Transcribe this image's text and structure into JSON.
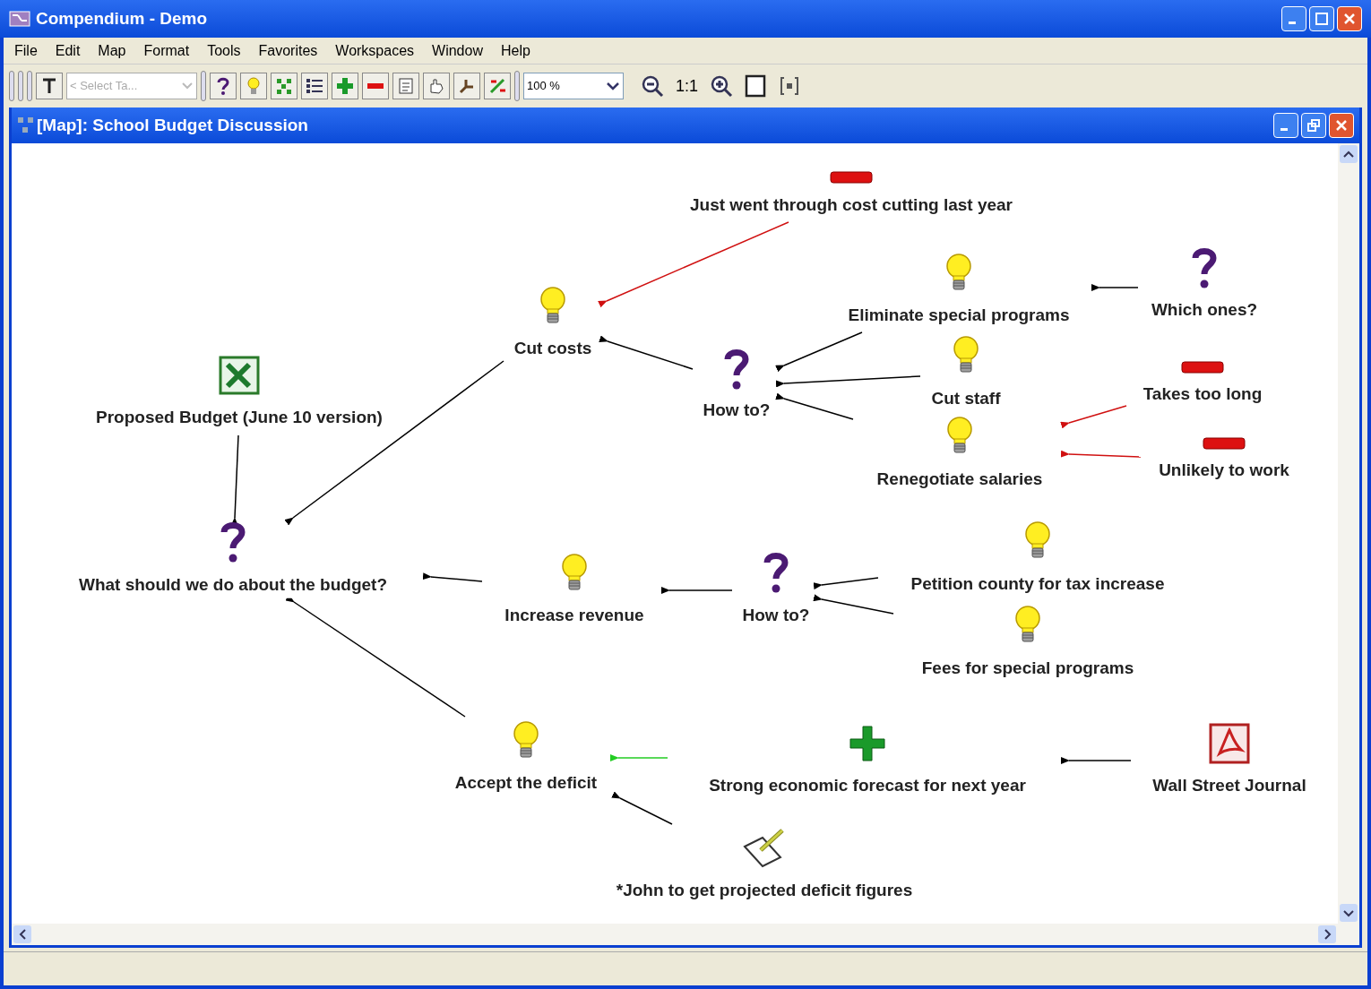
{
  "window": {
    "title": "Compendium - Demo"
  },
  "menu": [
    "File",
    "Edit",
    "Map",
    "Format",
    "Tools",
    "Favorites",
    "Workspaces",
    "Window",
    "Help"
  ],
  "toolbar": {
    "tag_select": {
      "placeholder": "< Select Ta...",
      "disabled": true
    },
    "zoom": "100 %",
    "actual_size": "1:1"
  },
  "map_window": {
    "title": "[Map]: School Budget Discussion"
  },
  "nodes": [
    {
      "kind": "con",
      "label": "Just went through cost cutting last year"
    },
    {
      "kind": "idea",
      "label": "Cut costs"
    },
    {
      "kind": "question",
      "label": "How to?"
    },
    {
      "kind": "idea",
      "label": "Eliminate special programs"
    },
    {
      "kind": "question",
      "label": "Which ones?"
    },
    {
      "kind": "idea",
      "label": "Cut staff"
    },
    {
      "kind": "con",
      "label": "Takes too long"
    },
    {
      "kind": "idea",
      "label": "Renegotiate salaries"
    },
    {
      "kind": "con",
      "label": "Unlikely to work"
    },
    {
      "kind": "spreadsheet",
      "label": "Proposed Budget (June 10 version)"
    },
    {
      "kind": "question",
      "label": "What should we do about the budget?"
    },
    {
      "kind": "idea",
      "label": "Increase revenue"
    },
    {
      "kind": "question",
      "label": "How to?"
    },
    {
      "kind": "idea",
      "label": "Petition county for tax increase"
    },
    {
      "kind": "idea",
      "label": "Fees for special programs"
    },
    {
      "kind": "idea",
      "label": "Accept the deficit"
    },
    {
      "kind": "pro",
      "label": "Strong economic forecast for next year"
    },
    {
      "kind": "pdf",
      "label": "Wall Street Journal"
    },
    {
      "kind": "action",
      "label": "*John to get projected deficit figures"
    }
  ],
  "links": [
    {
      "kind": "con"
    },
    {
      "kind": "plain"
    },
    {
      "kind": "plain"
    },
    {
      "kind": "plain"
    },
    {
      "kind": "plain"
    },
    {
      "kind": "plain"
    },
    {
      "kind": "con"
    },
    {
      "kind": "con"
    },
    {
      "kind": "plain"
    },
    {
      "kind": "plain"
    },
    {
      "kind": "plain"
    },
    {
      "kind": "plain"
    },
    {
      "kind": "plain"
    },
    {
      "kind": "plain"
    },
    {
      "kind": "plain"
    },
    {
      "kind": "pro"
    },
    {
      "kind": "plain"
    },
    {
      "kind": "plain"
    }
  ]
}
